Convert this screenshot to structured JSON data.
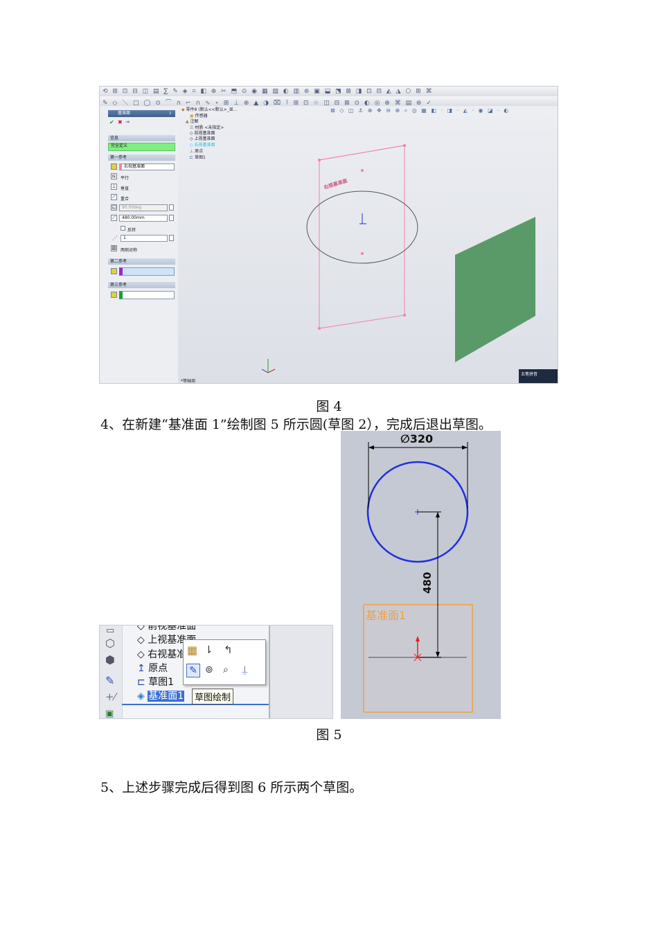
{
  "fig4": {
    "caption": "图 4",
    "property_panel": {
      "title": "基准面",
      "help": "?",
      "message_group": "信息",
      "message_status": "完全定义",
      "first_ref_group": "第一参考",
      "first_ref_value": "右视基准面",
      "options": [
        "平行",
        "垂直",
        "重合"
      ],
      "angle_value": "90.00deg",
      "distance_value": "480.00mm",
      "flip_label": "反转",
      "count_value": "1",
      "symmetric_label": "两侧对称",
      "second_ref_group": "第二参考",
      "third_ref_group": "第三参考"
    },
    "feature_tree": {
      "root": "零件8 (默认<<默认>_显...",
      "items": [
        "传感器",
        "注解",
        "材质 <未指定>",
        "前视基准面",
        "上视基准面",
        "右视基准面",
        "原点",
        "草图1"
      ]
    },
    "plane_label": "右视基准面",
    "view_label": "*等轴测",
    "ime_label": "五笔拼音"
  },
  "step4_text": "4、在新建“基准面 1”绘制图 5 所示圆(草图 2），完成后退出草图。",
  "fig5": {
    "caption": "图 5",
    "tree_items": [
      "前视基准面",
      "上视基准面",
      "右视基准",
      "原点",
      "草图1",
      "基准面1"
    ],
    "tooltip": "草图绘制",
    "diameter_dim": "∅320",
    "distance_dim": "480",
    "plane_label": "基准面1"
  },
  "step5_text": "5、上述步骤完成后得到图 6 所示两个草图。",
  "colors": {
    "circle": "#1f2fe0",
    "plane_orange": "#f0a040",
    "plane_pink": "#f080b0",
    "green_plane": "#5a9a68",
    "message_green": "#7ef07e"
  }
}
